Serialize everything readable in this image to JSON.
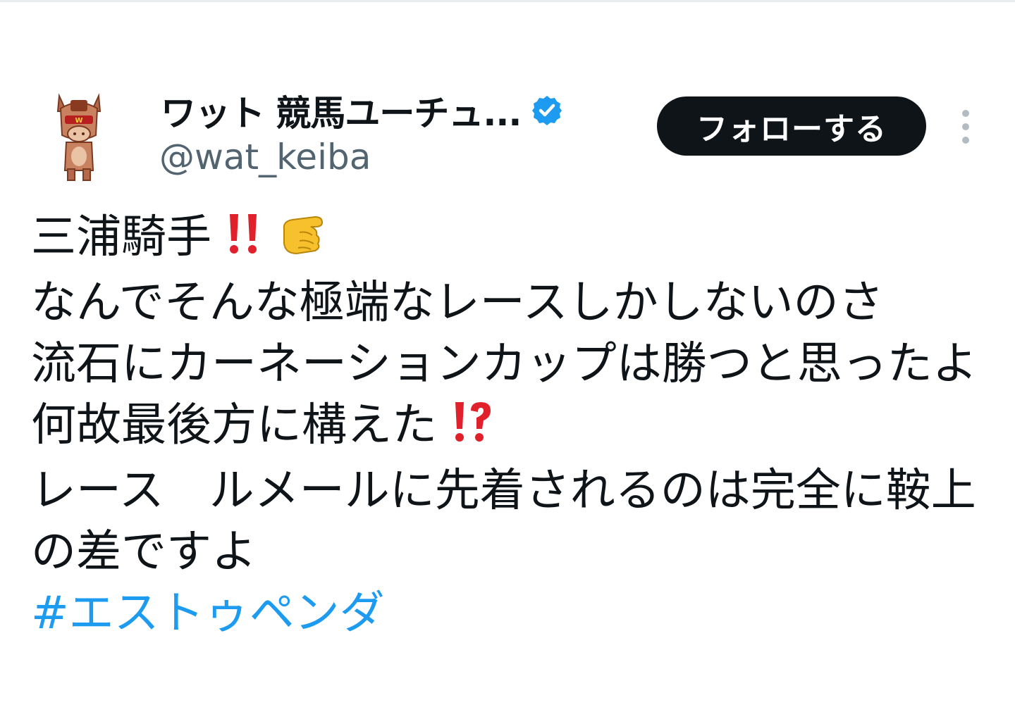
{
  "author": {
    "display_name": "ワット 競馬ユーチュ...",
    "handle": "@wat_keiba",
    "verified": true
  },
  "actions": {
    "follow_label": "フォローする"
  },
  "tweet": {
    "line1": "三浦騎手",
    "line2": "なんでそんな極端なレースしかしないのさ",
    "line3": "流石にカーネーションカップは勝つと思ったよ",
    "line4": "何故最後方に構えた",
    "line5": "レース　ルメールに先着されるのは完全に鞍上の差ですよ",
    "hashtag": "#エストゥペンダ"
  },
  "icons": {
    "avatar": "horse-mascot-icon",
    "verified": "verified-badge-icon",
    "more": "more-vertical-icon",
    "emoji_double_exclamation": "double-exclamation-emoji",
    "emoji_pointing_hand": "pointing-hand-emoji",
    "emoji_interrobang": "interrobang-emoji"
  },
  "colors": {
    "follow_button_bg": "#0f1419",
    "verified_blue": "#1d9bf0",
    "hashtag_blue": "#1d9bf0",
    "handle_gray": "#536471",
    "emoji_red": "#e0202a"
  }
}
